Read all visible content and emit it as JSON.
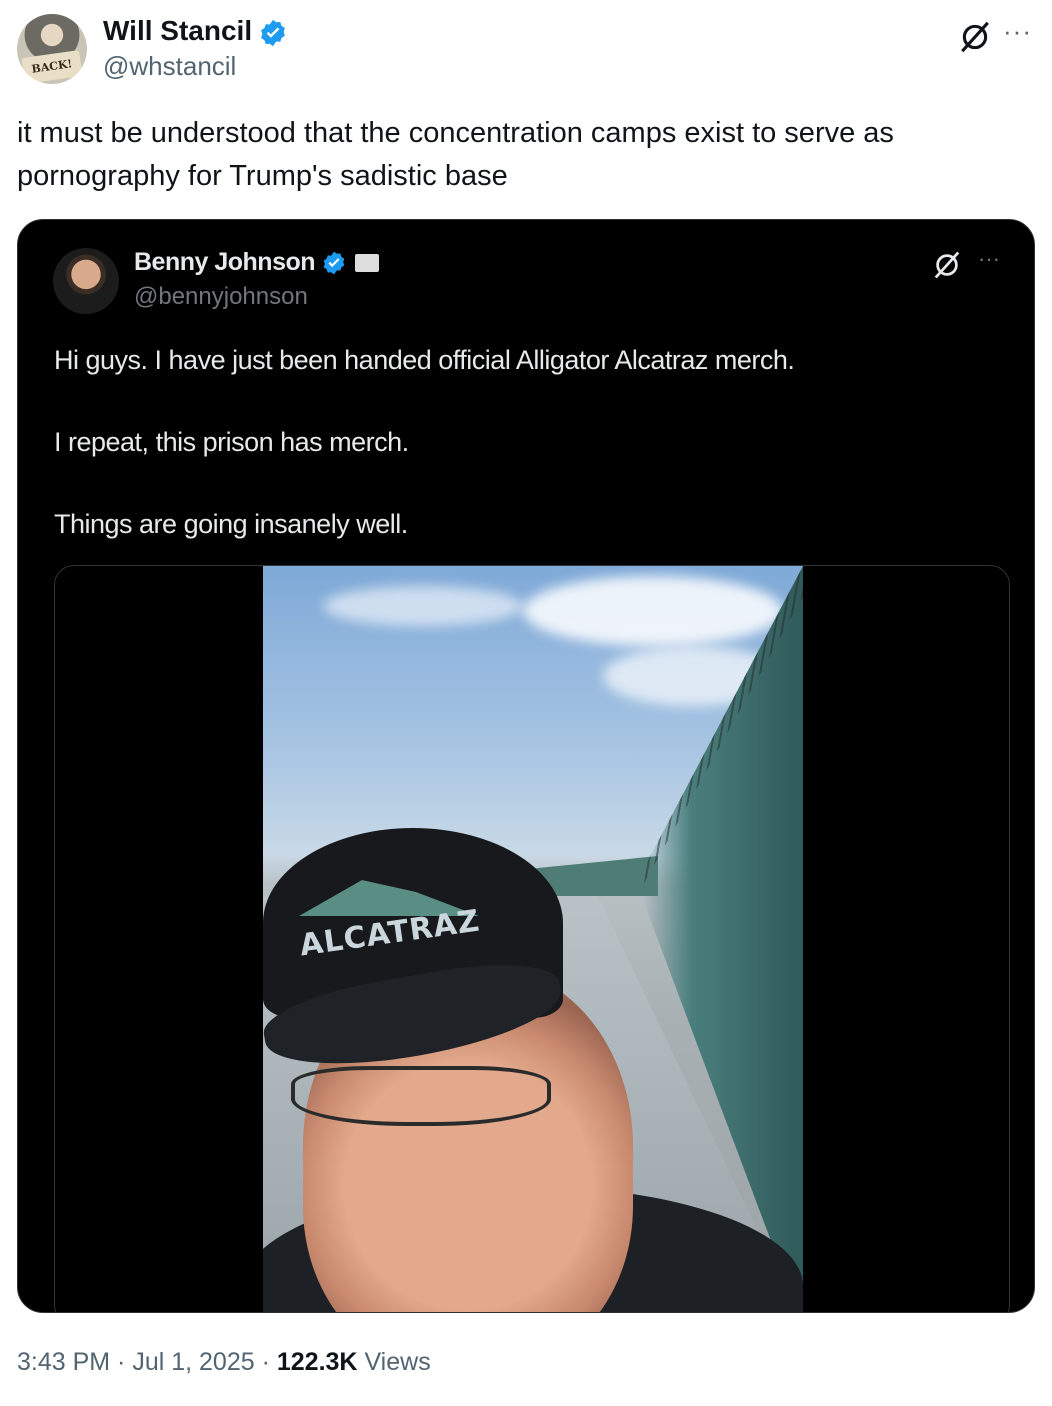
{
  "tweet": {
    "author_name": "Will Stancil",
    "author_handle": "@whstancil",
    "avatar_sign_text": "BACK!",
    "text": "it must be understood that the concentration camps exist to serve as pornography for Trump's sadistic base",
    "time": "3:43 PM",
    "date": "Jul 1, 2025",
    "views_count": "122.3K",
    "views_label": "Views",
    "more_label": "···"
  },
  "quote": {
    "author_name": "Benny Johnson",
    "author_handle": "@bennyjohnson",
    "more_label": "···",
    "lines": [
      "Hi guys. I have just been handed official Alligator Alcatraz merch.",
      "I repeat, this prison has merch.",
      "Things are going insanely well."
    ],
    "video_cap_text": "ALCATRAZ"
  },
  "colors": {
    "verified": "#1d9bf0",
    "text_primary": "#0f1419",
    "text_secondary": "#536471"
  }
}
